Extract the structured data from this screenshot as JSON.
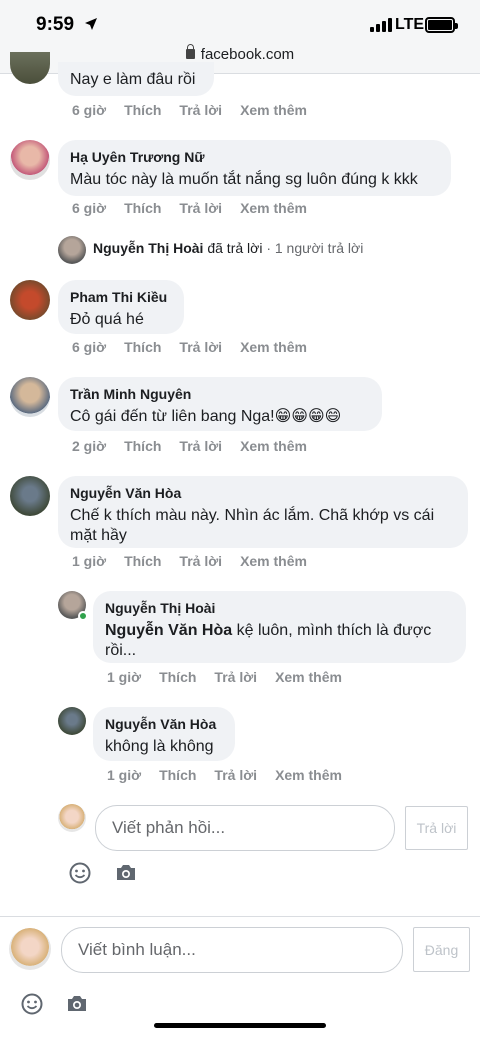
{
  "status_bar": {
    "time": "9:59",
    "network": "LTE",
    "url": "facebook.com"
  },
  "comments": [
    {
      "name": "",
      "text": "Nay e làm đâu rồi",
      "time": "6 giờ",
      "like": "Thích",
      "reply": "Trả lời",
      "more": "Xem thêm"
    },
    {
      "name": "Hạ Uyên Trương Nữ",
      "text": "Màu tóc này là muốn tắt nắng sg luôn đúng k kkk",
      "time": "6 giờ",
      "like": "Thích",
      "reply": "Trả lời",
      "more": "Xem thêm"
    },
    {
      "name": "Pham Thi Kiều",
      "text": "Đỏ quá hé",
      "time": "6 giờ",
      "like": "Thích",
      "reply": "Trả lời",
      "more": "Xem thêm"
    },
    {
      "name": "Trần Minh Nguyên",
      "text": "Cô gái đến từ liên bang Nga!😁😁😁😄",
      "time": "2 giờ",
      "like": "Thích",
      "reply": "Trả lời",
      "more": "Xem thêm"
    },
    {
      "name": "Nguyễn Văn Hòa",
      "text": "Chế k thích màu này. Nhìn ác lắm. Chã khớp vs cái mặt hầy",
      "time": "1 giờ",
      "like": "Thích",
      "reply": "Trả lời",
      "more": "Xem thêm"
    }
  ],
  "reply_summary": {
    "name": "Nguyễn Thị Hoài",
    "action": "đã trả lời",
    "count": "· 1 người trả lời"
  },
  "replies": [
    {
      "name": "Nguyễn Thị Hoài",
      "mention": "Nguyễn Văn Hòa",
      "text": "kệ luôn, mình thích là được rồi...",
      "time": "1 giờ",
      "like": "Thích",
      "reply": "Trả lời",
      "more": "Xem thêm"
    },
    {
      "name": "Nguyễn Văn Hòa",
      "mention": "",
      "text": "không là không",
      "time": "1 giờ",
      "like": "Thích",
      "reply": "Trả lời",
      "more": "Xem thêm"
    }
  ],
  "reply_input": {
    "placeholder": "Viết phản hồi...",
    "button": "Trả lời"
  },
  "comment_input": {
    "placeholder": "Viết bình luận...",
    "button": "Đăng"
  },
  "colors": {
    "bubble": "#f0f2f5",
    "meta": "#8a8d91",
    "online": "#31a24c"
  },
  "icons": [
    "location-arrow-icon",
    "lock-icon",
    "smiley-icon",
    "camera-icon"
  ]
}
